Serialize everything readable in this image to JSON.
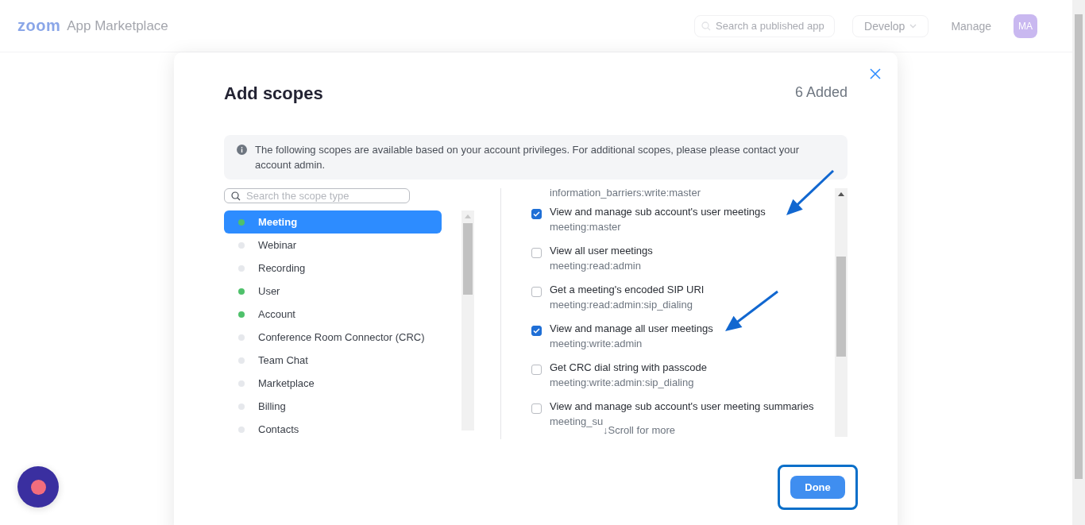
{
  "header": {
    "logo": "zoom",
    "product": "App Marketplace",
    "search": {
      "placeholder": "Search a published app"
    },
    "develop": "Develop",
    "manage": "Manage",
    "avatar": "MA"
  },
  "dialog": {
    "title": "Add scopes",
    "added": "6 Added",
    "info": "The following scopes are available based on your account privileges. For additional scopes, please please contact your account admin.",
    "search": {
      "placeholder": "Search the scope type"
    },
    "categories": [
      {
        "label": "Meeting",
        "color": "#4fc16b",
        "selected": true
      },
      {
        "label": "Webinar",
        "color": "#e6e8ec",
        "selected": false
      },
      {
        "label": "Recording",
        "color": "#e6e8ec",
        "selected": false
      },
      {
        "label": "User",
        "color": "#4fc16b",
        "selected": false
      },
      {
        "label": "Account",
        "color": "#4fc16b",
        "selected": false
      },
      {
        "label": "Conference Room Connector (CRC)",
        "color": "#e6e8ec",
        "selected": false
      },
      {
        "label": "Team Chat",
        "color": "#e6e8ec",
        "selected": false
      },
      {
        "label": "Marketplace",
        "color": "#e6e8ec",
        "selected": false
      },
      {
        "label": "Billing",
        "color": "#e6e8ec",
        "selected": false
      },
      {
        "label": "Contacts",
        "color": "#e6e8ec",
        "selected": false
      }
    ],
    "scopes": [
      {
        "code": "information_barriers:write:master"
      },
      {
        "title": "View and manage sub account's user meetings",
        "code": "meeting:master",
        "checked": true
      },
      {
        "title": "View all user meetings",
        "code": "meeting:read:admin",
        "checked": false
      },
      {
        "title": "Get a meeting's encoded SIP URI",
        "code": "meeting:read:admin:sip_dialing",
        "checked": false
      },
      {
        "title": "View and manage all user meetings",
        "code": "meeting:write:admin",
        "checked": true
      },
      {
        "title": "Get CRC dial string with passcode",
        "code": "meeting:write:admin:sip_dialing",
        "checked": false
      },
      {
        "title": "View and manage sub account's user meeting summaries",
        "code": "meeting_su",
        "checked": false
      }
    ],
    "scroll_hint": "↓Scroll for more",
    "done": "Done"
  }
}
